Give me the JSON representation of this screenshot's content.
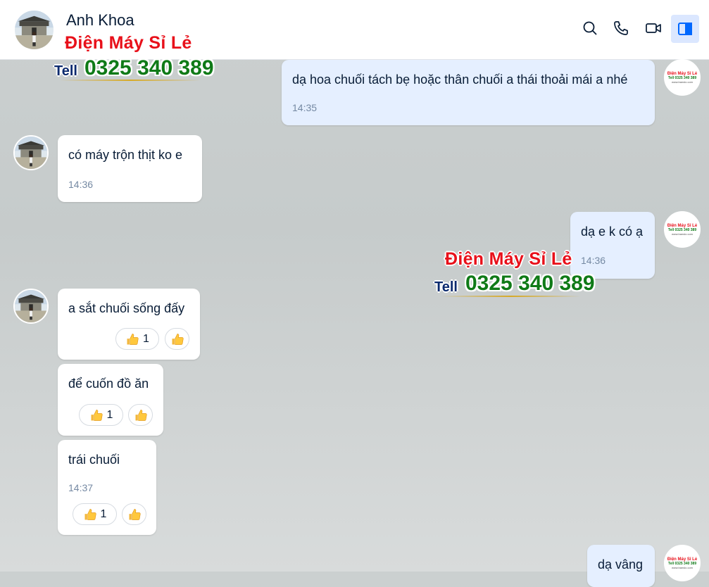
{
  "header": {
    "contact_name": "Anh Khoa"
  },
  "watermark": {
    "brand": "Điện Máy Sỉ Lẻ",
    "tell": "Tell",
    "phone": "0325 340 389"
  },
  "messages": [
    {
      "text": "dạ hoa chuối tách bẹ hoặc thân chuối a thái thoải mái a nhé",
      "time": "14:35"
    },
    {
      "text": "có máy trộn thịt ko e",
      "time": "14:36"
    },
    {
      "text": "dạ e k có ạ",
      "time": "14:36"
    },
    {
      "text": "a sắt chuối sống đấy",
      "reaction_count": "1"
    },
    {
      "text": "để cuốn đồ ăn",
      "reaction_count": "1"
    },
    {
      "text": "trái chuối",
      "time": "14:37",
      "reaction_count": "1"
    },
    {
      "text": "dạ vâng"
    }
  ],
  "logo_mini": {
    "brand": "Điện Máy Sỉ Lẻ",
    "phone": "Tell 0325 340 389",
    "site": "www.banslo.com"
  },
  "colors": {
    "my_bubble": "#e5efff",
    "their_bubble": "#ffffff",
    "brand_red": "#e8101a",
    "phone_green": "#0f7a17"
  }
}
